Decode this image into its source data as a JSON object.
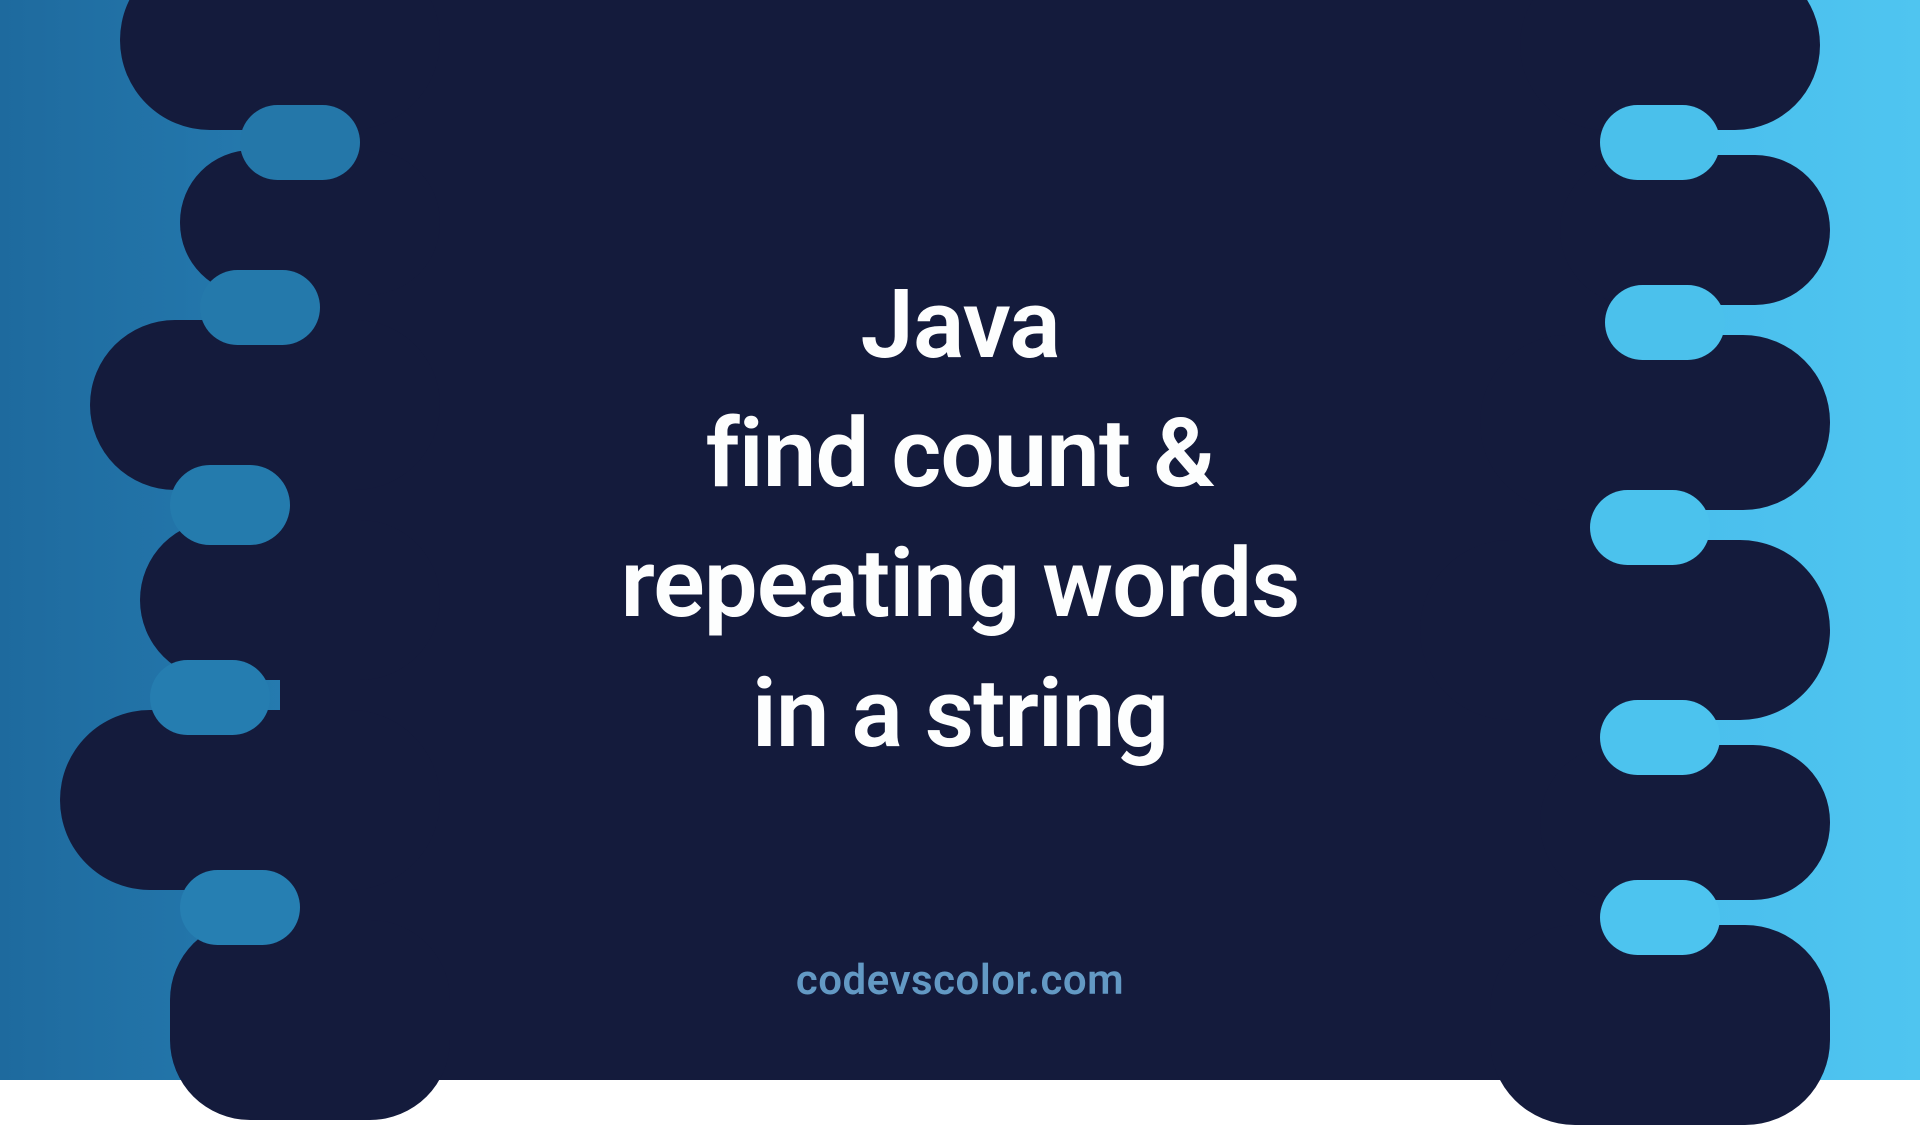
{
  "title": {
    "line1": "Java",
    "line2": "find count &",
    "line3": "repeating words",
    "line4": "in a string"
  },
  "footer": "codevscolor.com",
  "colors": {
    "blob": "#141b3c",
    "gradient_start": "#1e6a9e",
    "gradient_end": "#4fc5f0",
    "text_primary": "#fdfefe",
    "text_footer": "#6399c4"
  }
}
